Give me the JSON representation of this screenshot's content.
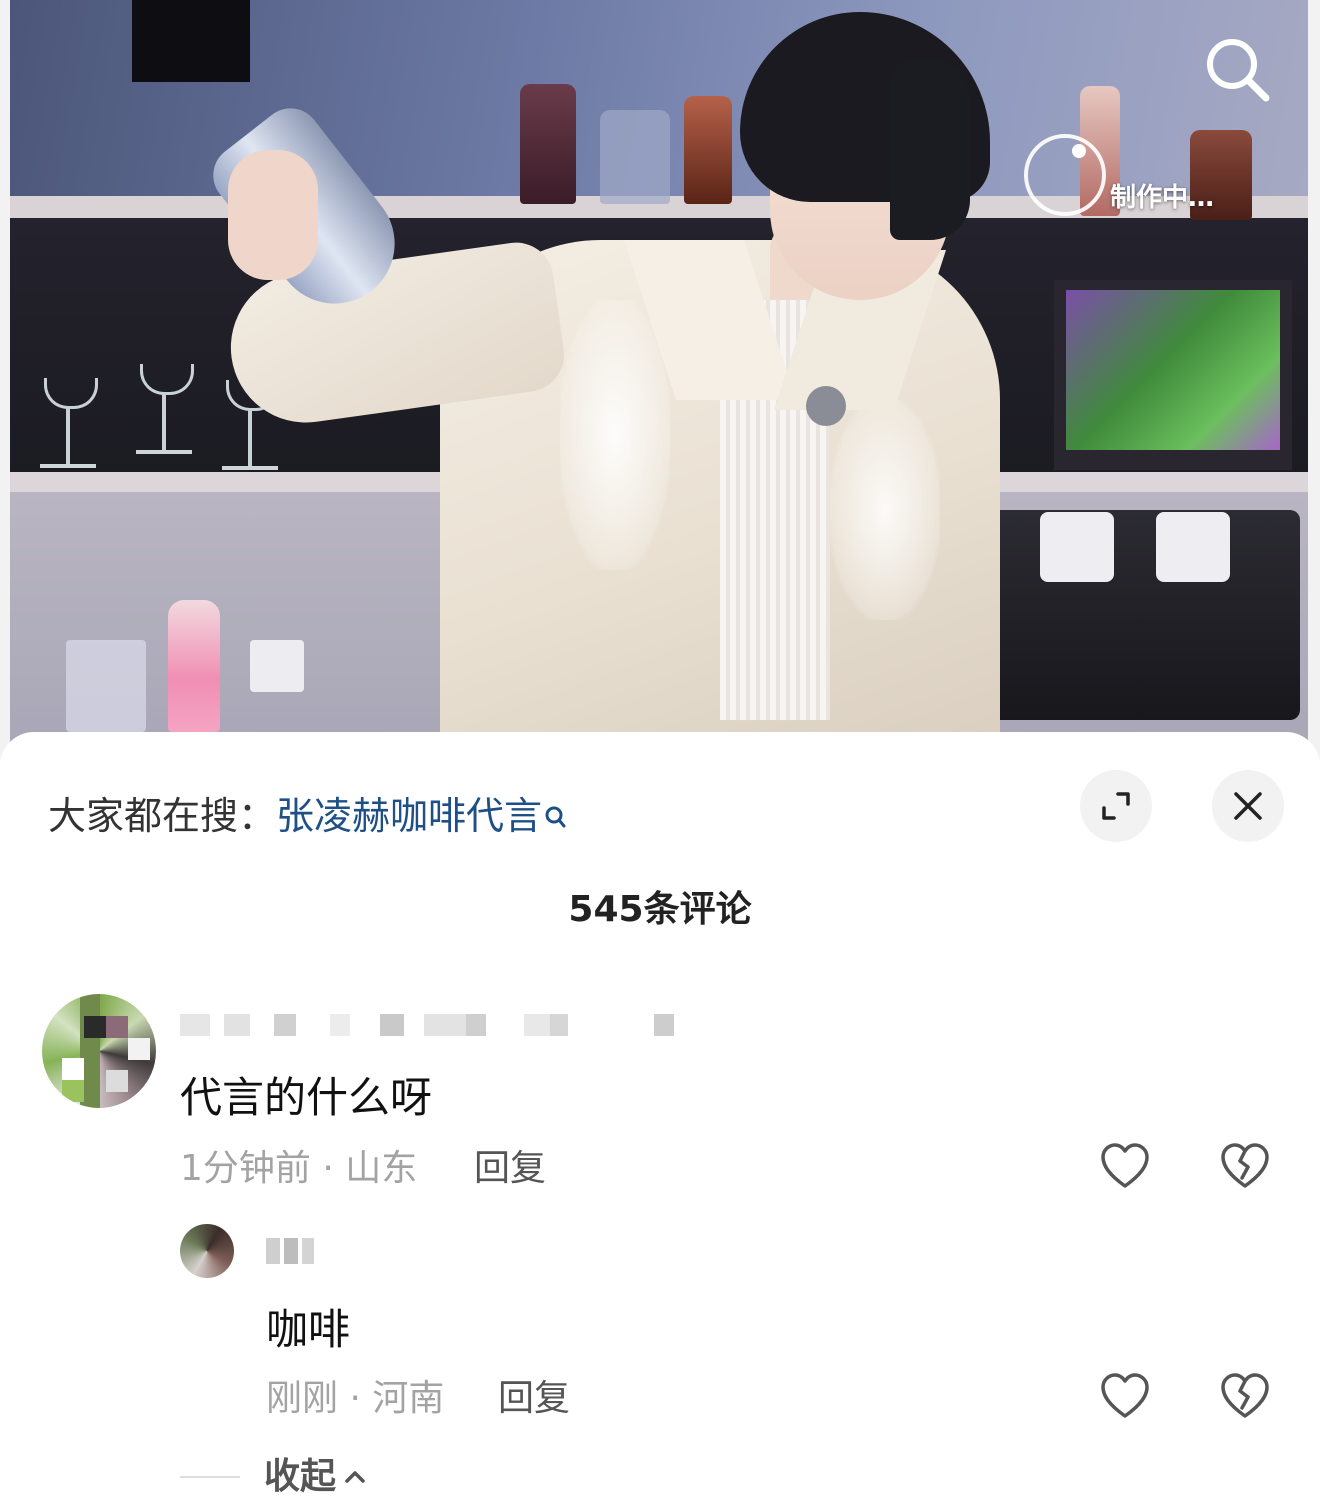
{
  "video": {
    "overlay_status": "制作中…",
    "icons": [
      "search-icon",
      "progress-ring-icon"
    ]
  },
  "comments_panel": {
    "trending_prefix": "大家都在搜：",
    "trending_keyword": "张凌赫咖啡代言",
    "comment_count": "545条评论",
    "icons": [
      "expand-icon",
      "close-icon"
    ]
  },
  "comments": [
    {
      "text": "代言的什么呀",
      "meta": "1分钟前 · 山东",
      "reply_label": "回复",
      "icons": [
        "heart-icon",
        "broken-heart-icon"
      ],
      "replies": [
        {
          "text": "咖啡",
          "meta": "刚刚 · 河南",
          "reply_label": "回复",
          "icons": [
            "heart-icon",
            "broken-heart-icon"
          ]
        }
      ]
    }
  ],
  "collapse_label": "收起",
  "colors": {
    "keyword_link": "#1e4f86",
    "meta_gray": "#a3a3a3",
    "button_bg": "#f2f2f2"
  }
}
